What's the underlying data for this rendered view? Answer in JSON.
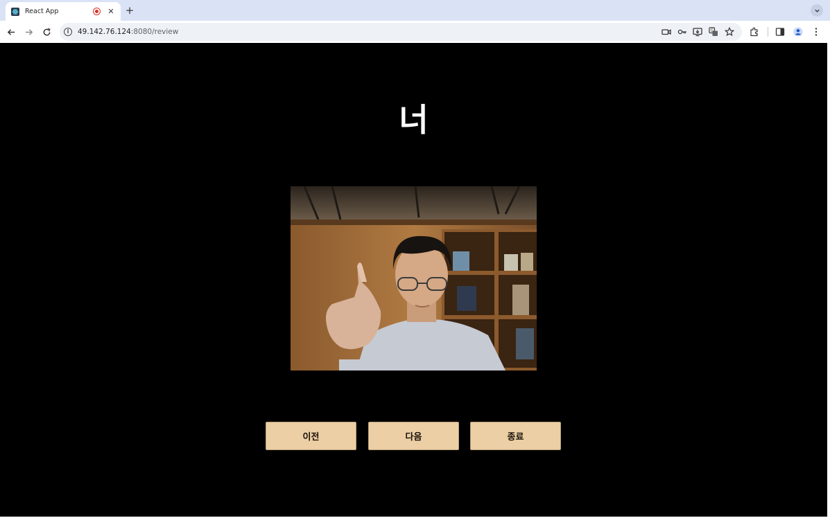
{
  "browser": {
    "tab_title": "React App",
    "url_host": "49.142.76.124",
    "url_path": ":8080/review",
    "icons": [
      "camera-icon",
      "key-icon",
      "install-icon",
      "translate-icon",
      "star-icon",
      "extensions-icon",
      "side-panel-icon",
      "profile-icon",
      "menu-icon"
    ]
  },
  "page": {
    "word": "너",
    "buttons": {
      "prev": "이전",
      "next": "다음",
      "end": "종료"
    }
  }
}
